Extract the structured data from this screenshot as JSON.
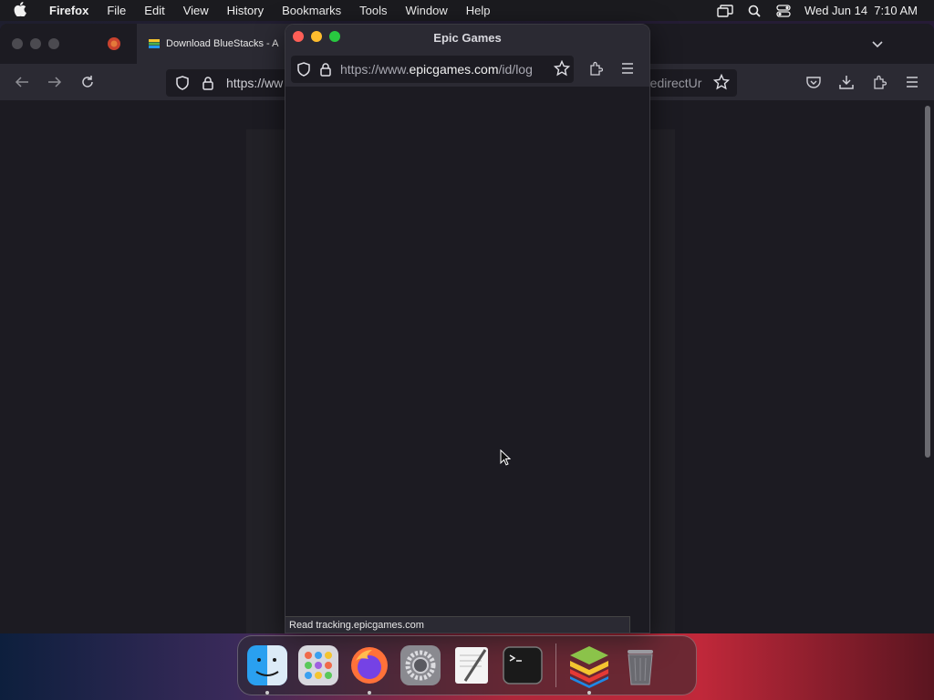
{
  "menubar": {
    "app_name": "Firefox",
    "items": [
      "File",
      "Edit",
      "View",
      "History",
      "Bookmarks",
      "Tools",
      "Window",
      "Help"
    ],
    "datetime": "Wed Jun 14  7:10 AM"
  },
  "main_window": {
    "tab_title": "Download BlueStacks - A",
    "url_visible_left": "https://ww",
    "url_visible_right": "redirectUr"
  },
  "popup": {
    "title": "Epic Games",
    "url_prefix": "https://www.",
    "url_domain": "epicgames.com",
    "url_suffix": "/id/log",
    "status_text": "Read tracking.epicgames.com"
  },
  "dock": {
    "items": [
      "finder",
      "launchpad",
      "firefox",
      "system-settings",
      "textedit",
      "terminal",
      "bluestacks",
      "trash"
    ]
  },
  "colors": {
    "close": "#fe5f57",
    "minimize": "#febc2e",
    "maximize": "#28c840"
  }
}
